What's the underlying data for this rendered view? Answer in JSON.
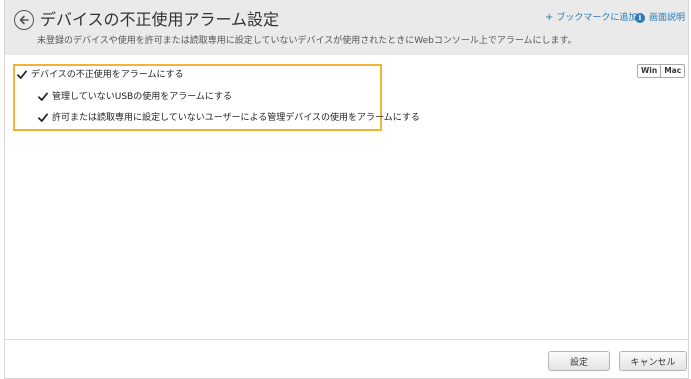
{
  "header": {
    "title": "デバイスの不正使用アラーム設定",
    "subtitle": "未登録のデバイスや使用を許可または読取専用に設定していないデバイスが使用されたときにWebコンソール上でアラームにします。",
    "bookmark_label": "ブックマークに追加",
    "help_label": "画面説明",
    "bookmark_icon": "plus-icon",
    "help_icon": "info-icon"
  },
  "os_toggle": {
    "win_label": "Win",
    "mac_label": "Mac"
  },
  "settings": {
    "main_label": "デバイスの不正使用をアラームにする",
    "main_checked": true,
    "usb_label": "管理していないUSBの使用をアラームにする",
    "usb_checked": true,
    "readonly_label": "許可または読取専用に設定していないユーザーによる管理デバイスの使用をアラームにする",
    "readonly_checked": true
  },
  "footer": {
    "save_label": "設定",
    "cancel_label": "キャンセル"
  },
  "colors": {
    "highlight": "#f5b335",
    "link": "#2a7ab8",
    "header_bg": "#eaeaea"
  }
}
